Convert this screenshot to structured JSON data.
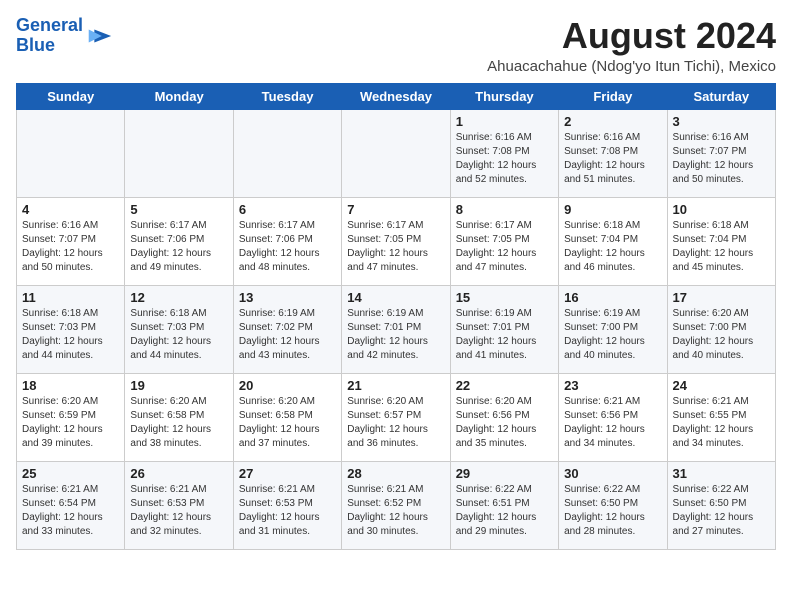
{
  "logo": {
    "line1": "General",
    "line2": "Blue"
  },
  "title": "August 2024",
  "subtitle": "Ahuacachahue (Ndog'yo Itun Tichi), Mexico",
  "days_of_week": [
    "Sunday",
    "Monday",
    "Tuesday",
    "Wednesday",
    "Thursday",
    "Friday",
    "Saturday"
  ],
  "weeks": [
    [
      {
        "day": "",
        "info": ""
      },
      {
        "day": "",
        "info": ""
      },
      {
        "day": "",
        "info": ""
      },
      {
        "day": "",
        "info": ""
      },
      {
        "day": "1",
        "info": "Sunrise: 6:16 AM\nSunset: 7:08 PM\nDaylight: 12 hours\nand 52 minutes."
      },
      {
        "day": "2",
        "info": "Sunrise: 6:16 AM\nSunset: 7:08 PM\nDaylight: 12 hours\nand 51 minutes."
      },
      {
        "day": "3",
        "info": "Sunrise: 6:16 AM\nSunset: 7:07 PM\nDaylight: 12 hours\nand 50 minutes."
      }
    ],
    [
      {
        "day": "4",
        "info": "Sunrise: 6:16 AM\nSunset: 7:07 PM\nDaylight: 12 hours\nand 50 minutes."
      },
      {
        "day": "5",
        "info": "Sunrise: 6:17 AM\nSunset: 7:06 PM\nDaylight: 12 hours\nand 49 minutes."
      },
      {
        "day": "6",
        "info": "Sunrise: 6:17 AM\nSunset: 7:06 PM\nDaylight: 12 hours\nand 48 minutes."
      },
      {
        "day": "7",
        "info": "Sunrise: 6:17 AM\nSunset: 7:05 PM\nDaylight: 12 hours\nand 47 minutes."
      },
      {
        "day": "8",
        "info": "Sunrise: 6:17 AM\nSunset: 7:05 PM\nDaylight: 12 hours\nand 47 minutes."
      },
      {
        "day": "9",
        "info": "Sunrise: 6:18 AM\nSunset: 7:04 PM\nDaylight: 12 hours\nand 46 minutes."
      },
      {
        "day": "10",
        "info": "Sunrise: 6:18 AM\nSunset: 7:04 PM\nDaylight: 12 hours\nand 45 minutes."
      }
    ],
    [
      {
        "day": "11",
        "info": "Sunrise: 6:18 AM\nSunset: 7:03 PM\nDaylight: 12 hours\nand 44 minutes."
      },
      {
        "day": "12",
        "info": "Sunrise: 6:18 AM\nSunset: 7:03 PM\nDaylight: 12 hours\nand 44 minutes."
      },
      {
        "day": "13",
        "info": "Sunrise: 6:19 AM\nSunset: 7:02 PM\nDaylight: 12 hours\nand 43 minutes."
      },
      {
        "day": "14",
        "info": "Sunrise: 6:19 AM\nSunset: 7:01 PM\nDaylight: 12 hours\nand 42 minutes."
      },
      {
        "day": "15",
        "info": "Sunrise: 6:19 AM\nSunset: 7:01 PM\nDaylight: 12 hours\nand 41 minutes."
      },
      {
        "day": "16",
        "info": "Sunrise: 6:19 AM\nSunset: 7:00 PM\nDaylight: 12 hours\nand 40 minutes."
      },
      {
        "day": "17",
        "info": "Sunrise: 6:20 AM\nSunset: 7:00 PM\nDaylight: 12 hours\nand 40 minutes."
      }
    ],
    [
      {
        "day": "18",
        "info": "Sunrise: 6:20 AM\nSunset: 6:59 PM\nDaylight: 12 hours\nand 39 minutes."
      },
      {
        "day": "19",
        "info": "Sunrise: 6:20 AM\nSunset: 6:58 PM\nDaylight: 12 hours\nand 38 minutes."
      },
      {
        "day": "20",
        "info": "Sunrise: 6:20 AM\nSunset: 6:58 PM\nDaylight: 12 hours\nand 37 minutes."
      },
      {
        "day": "21",
        "info": "Sunrise: 6:20 AM\nSunset: 6:57 PM\nDaylight: 12 hours\nand 36 minutes."
      },
      {
        "day": "22",
        "info": "Sunrise: 6:20 AM\nSunset: 6:56 PM\nDaylight: 12 hours\nand 35 minutes."
      },
      {
        "day": "23",
        "info": "Sunrise: 6:21 AM\nSunset: 6:56 PM\nDaylight: 12 hours\nand 34 minutes."
      },
      {
        "day": "24",
        "info": "Sunrise: 6:21 AM\nSunset: 6:55 PM\nDaylight: 12 hours\nand 34 minutes."
      }
    ],
    [
      {
        "day": "25",
        "info": "Sunrise: 6:21 AM\nSunset: 6:54 PM\nDaylight: 12 hours\nand 33 minutes."
      },
      {
        "day": "26",
        "info": "Sunrise: 6:21 AM\nSunset: 6:53 PM\nDaylight: 12 hours\nand 32 minutes."
      },
      {
        "day": "27",
        "info": "Sunrise: 6:21 AM\nSunset: 6:53 PM\nDaylight: 12 hours\nand 31 minutes."
      },
      {
        "day": "28",
        "info": "Sunrise: 6:21 AM\nSunset: 6:52 PM\nDaylight: 12 hours\nand 30 minutes."
      },
      {
        "day": "29",
        "info": "Sunrise: 6:22 AM\nSunset: 6:51 PM\nDaylight: 12 hours\nand 29 minutes."
      },
      {
        "day": "30",
        "info": "Sunrise: 6:22 AM\nSunset: 6:50 PM\nDaylight: 12 hours\nand 28 minutes."
      },
      {
        "day": "31",
        "info": "Sunrise: 6:22 AM\nSunset: 6:50 PM\nDaylight: 12 hours\nand 27 minutes."
      }
    ]
  ]
}
